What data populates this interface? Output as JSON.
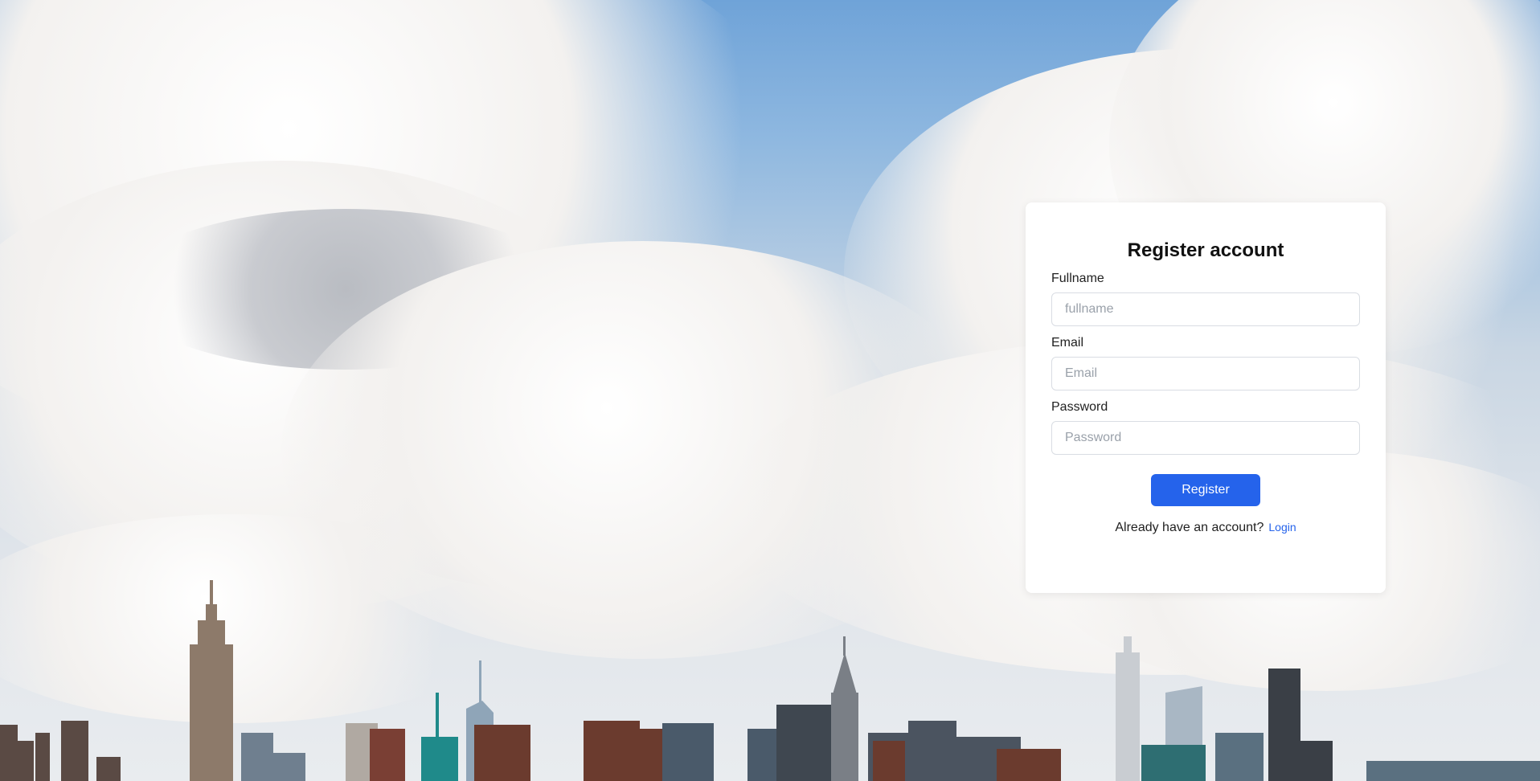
{
  "form": {
    "title": "Register account",
    "fullname_label": "Fullname",
    "fullname_placeholder": "fullname",
    "email_label": "Email",
    "email_placeholder": "Email",
    "password_label": "Password",
    "password_placeholder": "Password",
    "submit_label": "Register",
    "login_prompt": "Already have an account?",
    "login_link": "Login"
  },
  "colors": {
    "accent": "#2563eb",
    "sky": "#6fa3d8",
    "card": "#ffffff"
  }
}
